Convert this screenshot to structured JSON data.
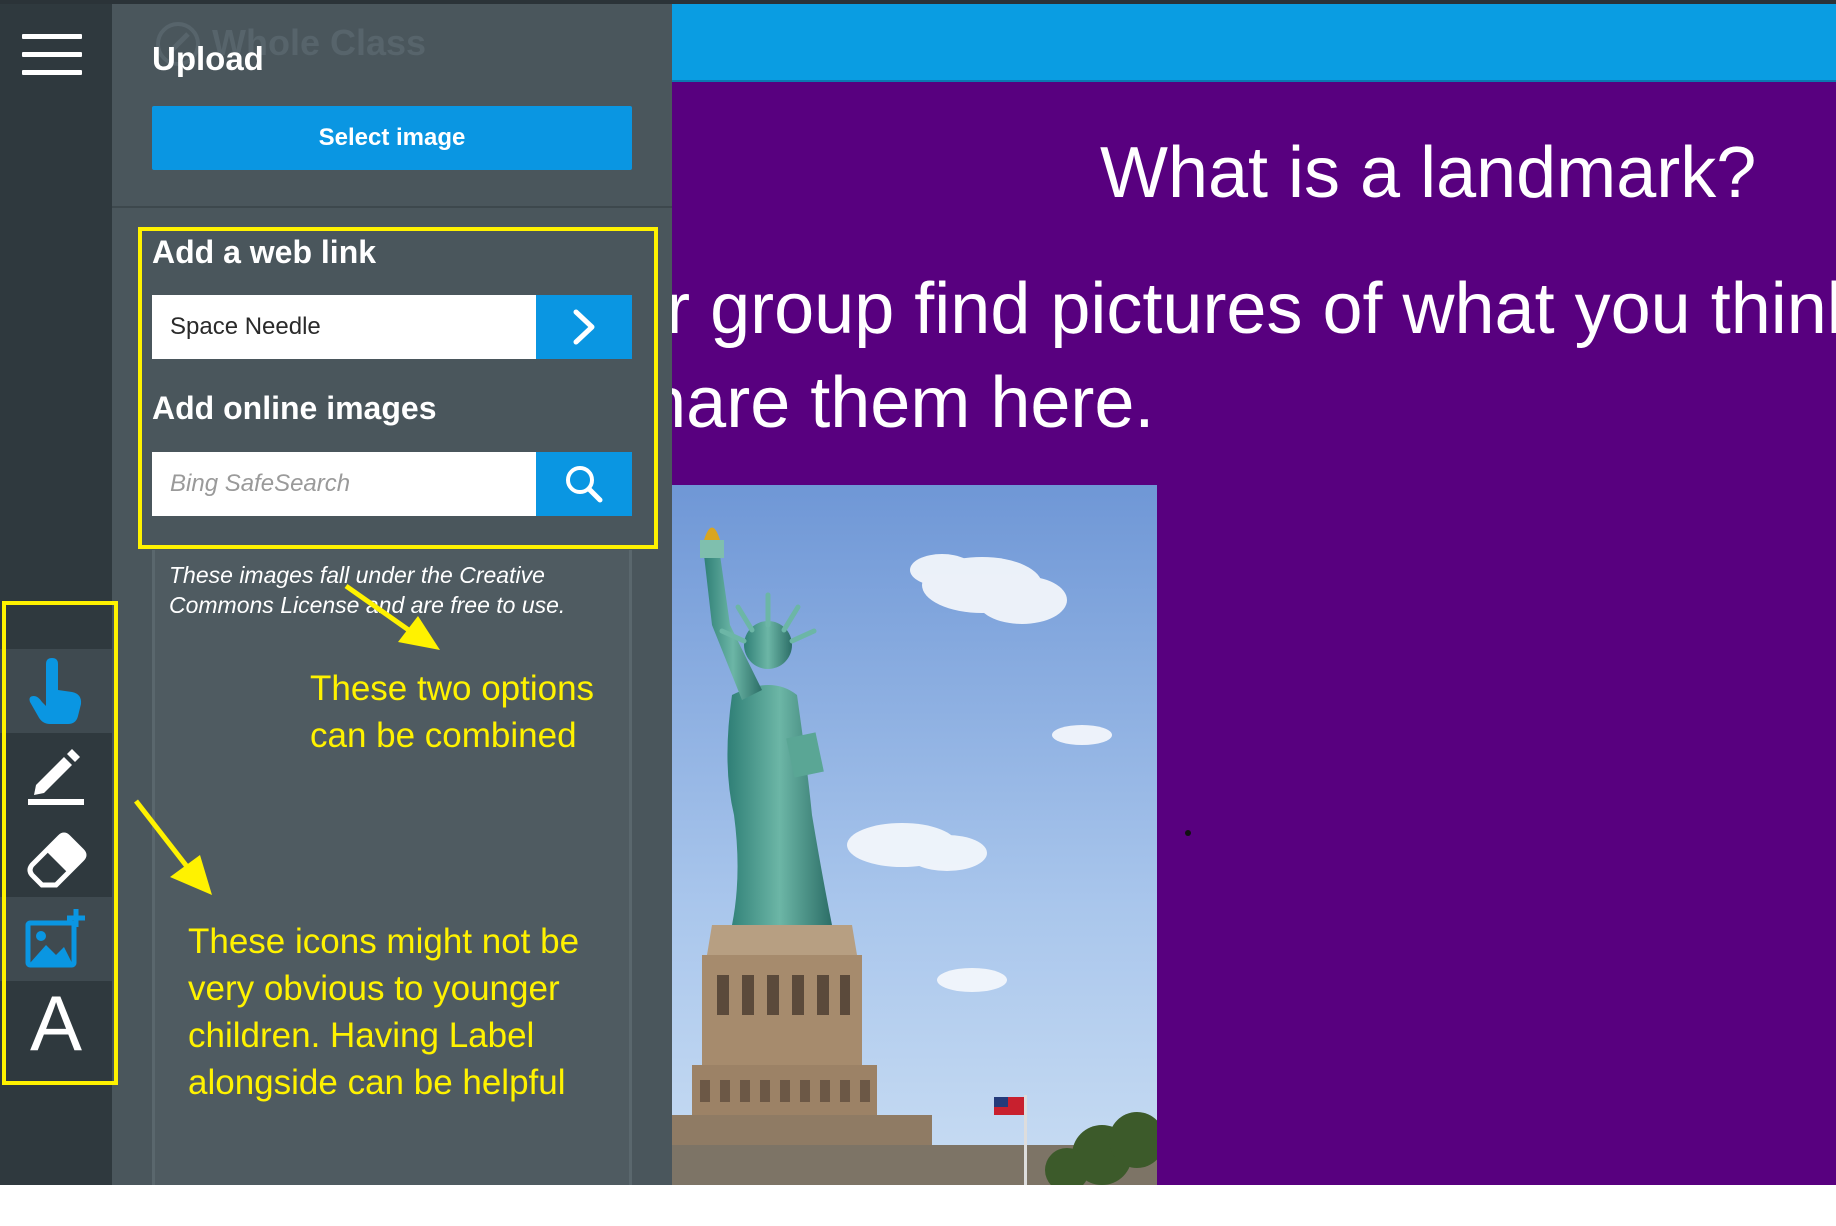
{
  "panel": {
    "ghost_title": "Whole Class",
    "upload_title": "Upload",
    "select_image_label": "Select image",
    "web_link": {
      "title": "Add a web link",
      "value": "Space Needle"
    },
    "online_images": {
      "title": "Add online images",
      "placeholder": "Bing SafeSearch"
    },
    "license_text": "These images fall under the Creative Commons License and are free to use."
  },
  "toolbar": {
    "tools": [
      {
        "name": "pointer",
        "icon": "hand-pointer-icon"
      },
      {
        "name": "pen",
        "icon": "pencil-icon"
      },
      {
        "name": "eraser",
        "icon": "eraser-icon"
      },
      {
        "name": "add-image",
        "icon": "add-image-icon"
      },
      {
        "name": "text",
        "icon": "text-icon",
        "glyph": "A"
      }
    ],
    "active_tools": [
      "pointer",
      "add-image"
    ]
  },
  "slide": {
    "title": "What is a landmark?",
    "body_line1": "In your group find pictures of what you think",
    "body_line2": "and share them here.",
    "image": "statue-of-liberty-photo"
  },
  "annotations": {
    "combined_note": "These two options can be combined",
    "icons_note": "These icons might not be very obvious to younger children. Having Label alongside can be helpful"
  },
  "colors": {
    "rail_bg": "#2f393e",
    "panel_bg": "#4a565c",
    "accent_blue": "#0a96e2",
    "slide_purple": "#58007f",
    "annotation_yellow": "#fff200"
  }
}
